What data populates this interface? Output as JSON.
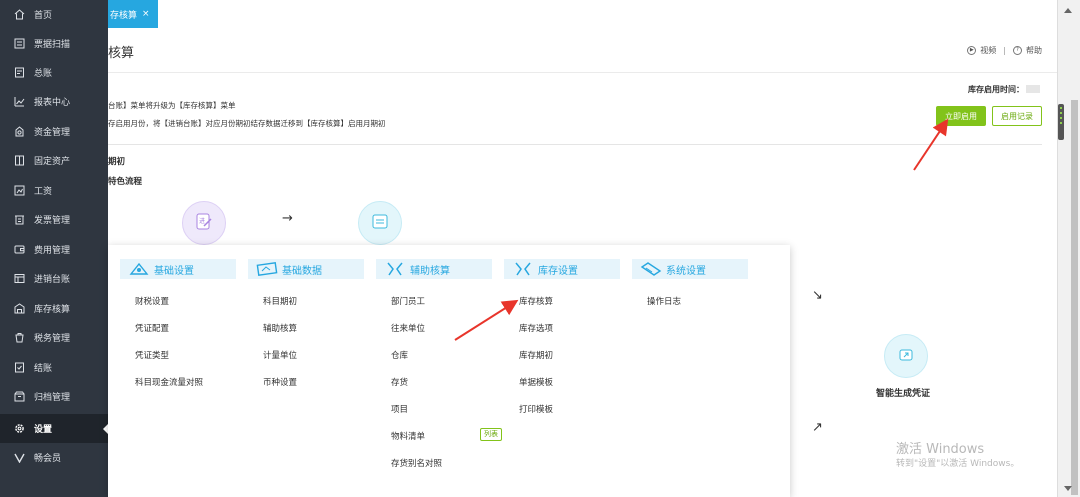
{
  "sidebar": {
    "items": [
      {
        "label": "首页",
        "icon": "home-icon"
      },
      {
        "label": "票据扫描",
        "icon": "scan-icon"
      },
      {
        "label": "总账",
        "icon": "ledger-icon"
      },
      {
        "label": "报表中心",
        "icon": "chart-icon"
      },
      {
        "label": "资金管理",
        "icon": "money-icon"
      },
      {
        "label": "固定资产",
        "icon": "asset-icon"
      },
      {
        "label": "工资",
        "icon": "salary-icon"
      },
      {
        "label": "发票管理",
        "icon": "invoice-icon"
      },
      {
        "label": "费用管理",
        "icon": "wallet-icon"
      },
      {
        "label": "进销台账",
        "icon": "account-book-icon"
      },
      {
        "label": "库存核算",
        "icon": "warehouse-icon"
      },
      {
        "label": "税务管理",
        "icon": "tax-icon"
      },
      {
        "label": "结账",
        "icon": "checkout-icon"
      },
      {
        "label": "归档管理",
        "icon": "archive-icon"
      },
      {
        "label": "设置",
        "icon": "gear-icon"
      },
      {
        "label": "畅会员",
        "icon": "vip-icon"
      }
    ],
    "active_index": 14
  },
  "tabs": [
    {
      "label": "存核算",
      "close": "×"
    }
  ],
  "page": {
    "title": "核算",
    "video_label": "视频",
    "separator": "|",
    "help_label": "帮助",
    "notice_line1": "台账】菜单将升级为【库存核算】菜单",
    "notice_line2": "存启用月份，将【进销台账】对应月份期初结存数据迁移到【库存核算】启用月期初",
    "start_time_label": "库存启用时间：",
    "enable_button": "立即启用",
    "log_button": "启用记录",
    "section_opening": "期初",
    "section_flow": "特色流程",
    "flow_arrow": "→",
    "flow_arrow2": "↘",
    "flow_arrow3": "↗",
    "generate_voucher": "智能生成凭证"
  },
  "menu": {
    "columns": [
      {
        "title": "基础设置",
        "icon": "basic-settings-icon",
        "items": [
          "财税设置",
          "凭证配置",
          "凭证类型",
          "科目现金流量对照"
        ]
      },
      {
        "title": "基础数据",
        "icon": "basic-data-icon",
        "items": [
          "科目期初",
          "辅助核算",
          "计量单位",
          "币种设置"
        ]
      },
      {
        "title": "辅助核算",
        "icon": "auxiliary-icon",
        "items": [
          "部门员工",
          "往来单位",
          "仓库",
          "存货",
          "项目",
          "物料清单",
          "存货别名对照"
        ]
      },
      {
        "title": "库存设置",
        "icon": "inventory-settings-icon",
        "items": [
          "库存核算",
          "库存选项",
          "库存期初",
          "单据模板",
          "打印模板"
        ]
      },
      {
        "title": "系统设置",
        "icon": "system-settings-icon",
        "items": [
          "操作日志"
        ]
      }
    ],
    "badge": "列表"
  },
  "watermark": {
    "line1": "激活 Windows",
    "line2": "转到\"设置\"以激活 Windows。"
  },
  "colors": {
    "sidebar_bg": "#2f3640",
    "accent_blue": "#26a7e0",
    "accent_green": "#82c31a",
    "annotation_red": "#e8352b"
  }
}
